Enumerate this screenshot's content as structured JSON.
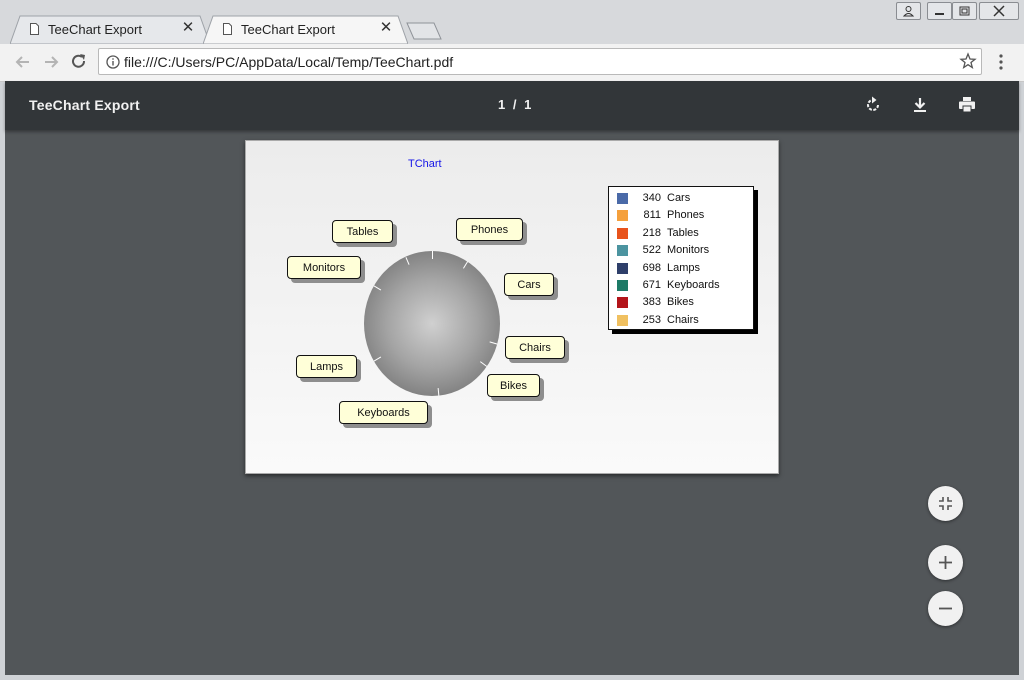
{
  "browser": {
    "tabs": [
      {
        "label": "TeeChart Export",
        "icon": "document-icon",
        "active": false
      },
      {
        "label": "TeeChart Export",
        "icon": "document-icon",
        "active": true
      }
    ],
    "address": "file:///C:/Users/PC/AppData/Local/Temp/TeeChart.pdf"
  },
  "pdf_viewer": {
    "title": "TeeChart Export",
    "current_page": "1",
    "page_separator": "/",
    "total_pages": "1"
  },
  "chart_data": {
    "type": "pie",
    "title": "TChart",
    "categories": [
      "Cars",
      "Phones",
      "Tables",
      "Monitors",
      "Lamps",
      "Keyboards",
      "Bikes",
      "Chairs"
    ],
    "values": [
      340,
      811,
      218,
      522,
      698,
      671,
      383,
      253
    ],
    "colors": [
      "#4a6aa8",
      "#f5a03c",
      "#e8531c",
      "#4c94a0",
      "#2e3f6a",
      "#1d7a66",
      "#b3141a",
      "#f0c060"
    ],
    "legend": "right"
  },
  "colors": {
    "pdf_toolbar": "#323639",
    "pdf_background": "#525659",
    "chart_title": "#1515e8",
    "callout_fill": "#ffffd8"
  }
}
